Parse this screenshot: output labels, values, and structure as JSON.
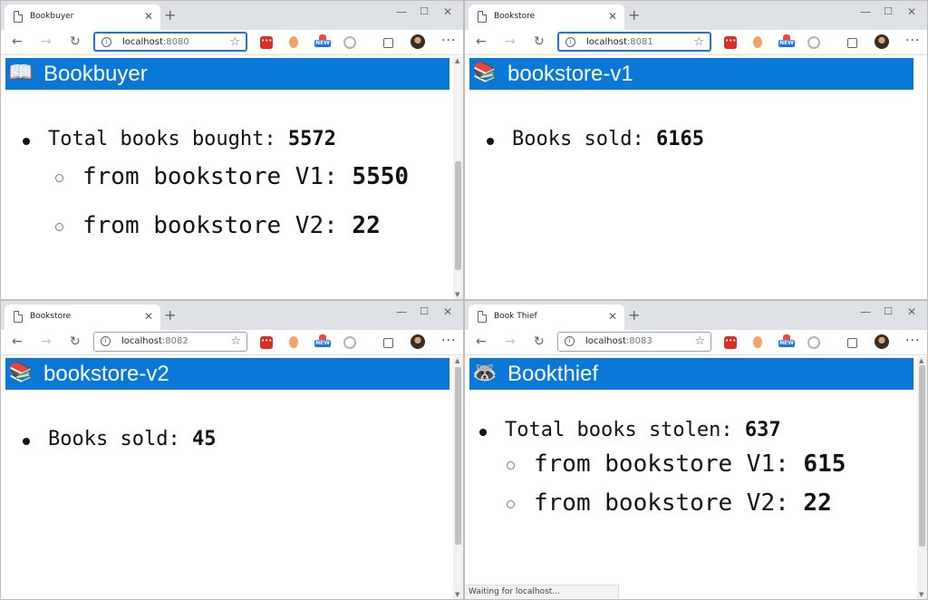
{
  "windows": [
    {
      "tab_title": "Bookbuyer",
      "url_host": "localhost",
      "url_port": ":8080",
      "header": {
        "emoji": "📖",
        "title": "Bookbuyer"
      },
      "total_label": "Total books bought: ",
      "total_value": "5572",
      "from_v1_label": "from bookstore V1: ",
      "from_v1_value": "5550",
      "from_v2_label": "from bookstore V2: ",
      "from_v2_value": "22"
    },
    {
      "tab_title": "Bookstore",
      "url_host": "localhost",
      "url_port": ":8081",
      "header": {
        "emoji": "📚",
        "title": "bookstore-v1"
      },
      "sold_label": "Books sold: ",
      "sold_value": "6165"
    },
    {
      "tab_title": "Bookstore",
      "url_host": "localhost",
      "url_port": ":8082",
      "header": {
        "emoji": "📚",
        "title": "bookstore-v2"
      },
      "sold_label": "Books sold: ",
      "sold_value": "45"
    },
    {
      "tab_title": "Book Thief",
      "url_host": "localhost",
      "url_port": ":8083",
      "header": {
        "emoji": "🦝",
        "title": "Bookthief"
      },
      "total_label": "Total books stolen: ",
      "total_value": "637",
      "from_v1_label": "from bookstore V1: ",
      "from_v1_value": "615",
      "from_v2_label": "from bookstore V2: ",
      "from_v2_value": "22",
      "status_text": "Waiting for localhost..."
    }
  ],
  "common": {
    "new_tab": "+",
    "tab_close": "✕",
    "win_min": "—",
    "win_max": "☐",
    "win_close": "✕",
    "back": "←",
    "forward": "→",
    "reload": "↻",
    "info": "i",
    "star": "☆",
    "menu": "···",
    "new_badge": "NEW"
  },
  "colors": {
    "header_bg": "#0a78d7",
    "tabstrip_bg": "#dee1e6",
    "focus": "#1a73e8"
  }
}
